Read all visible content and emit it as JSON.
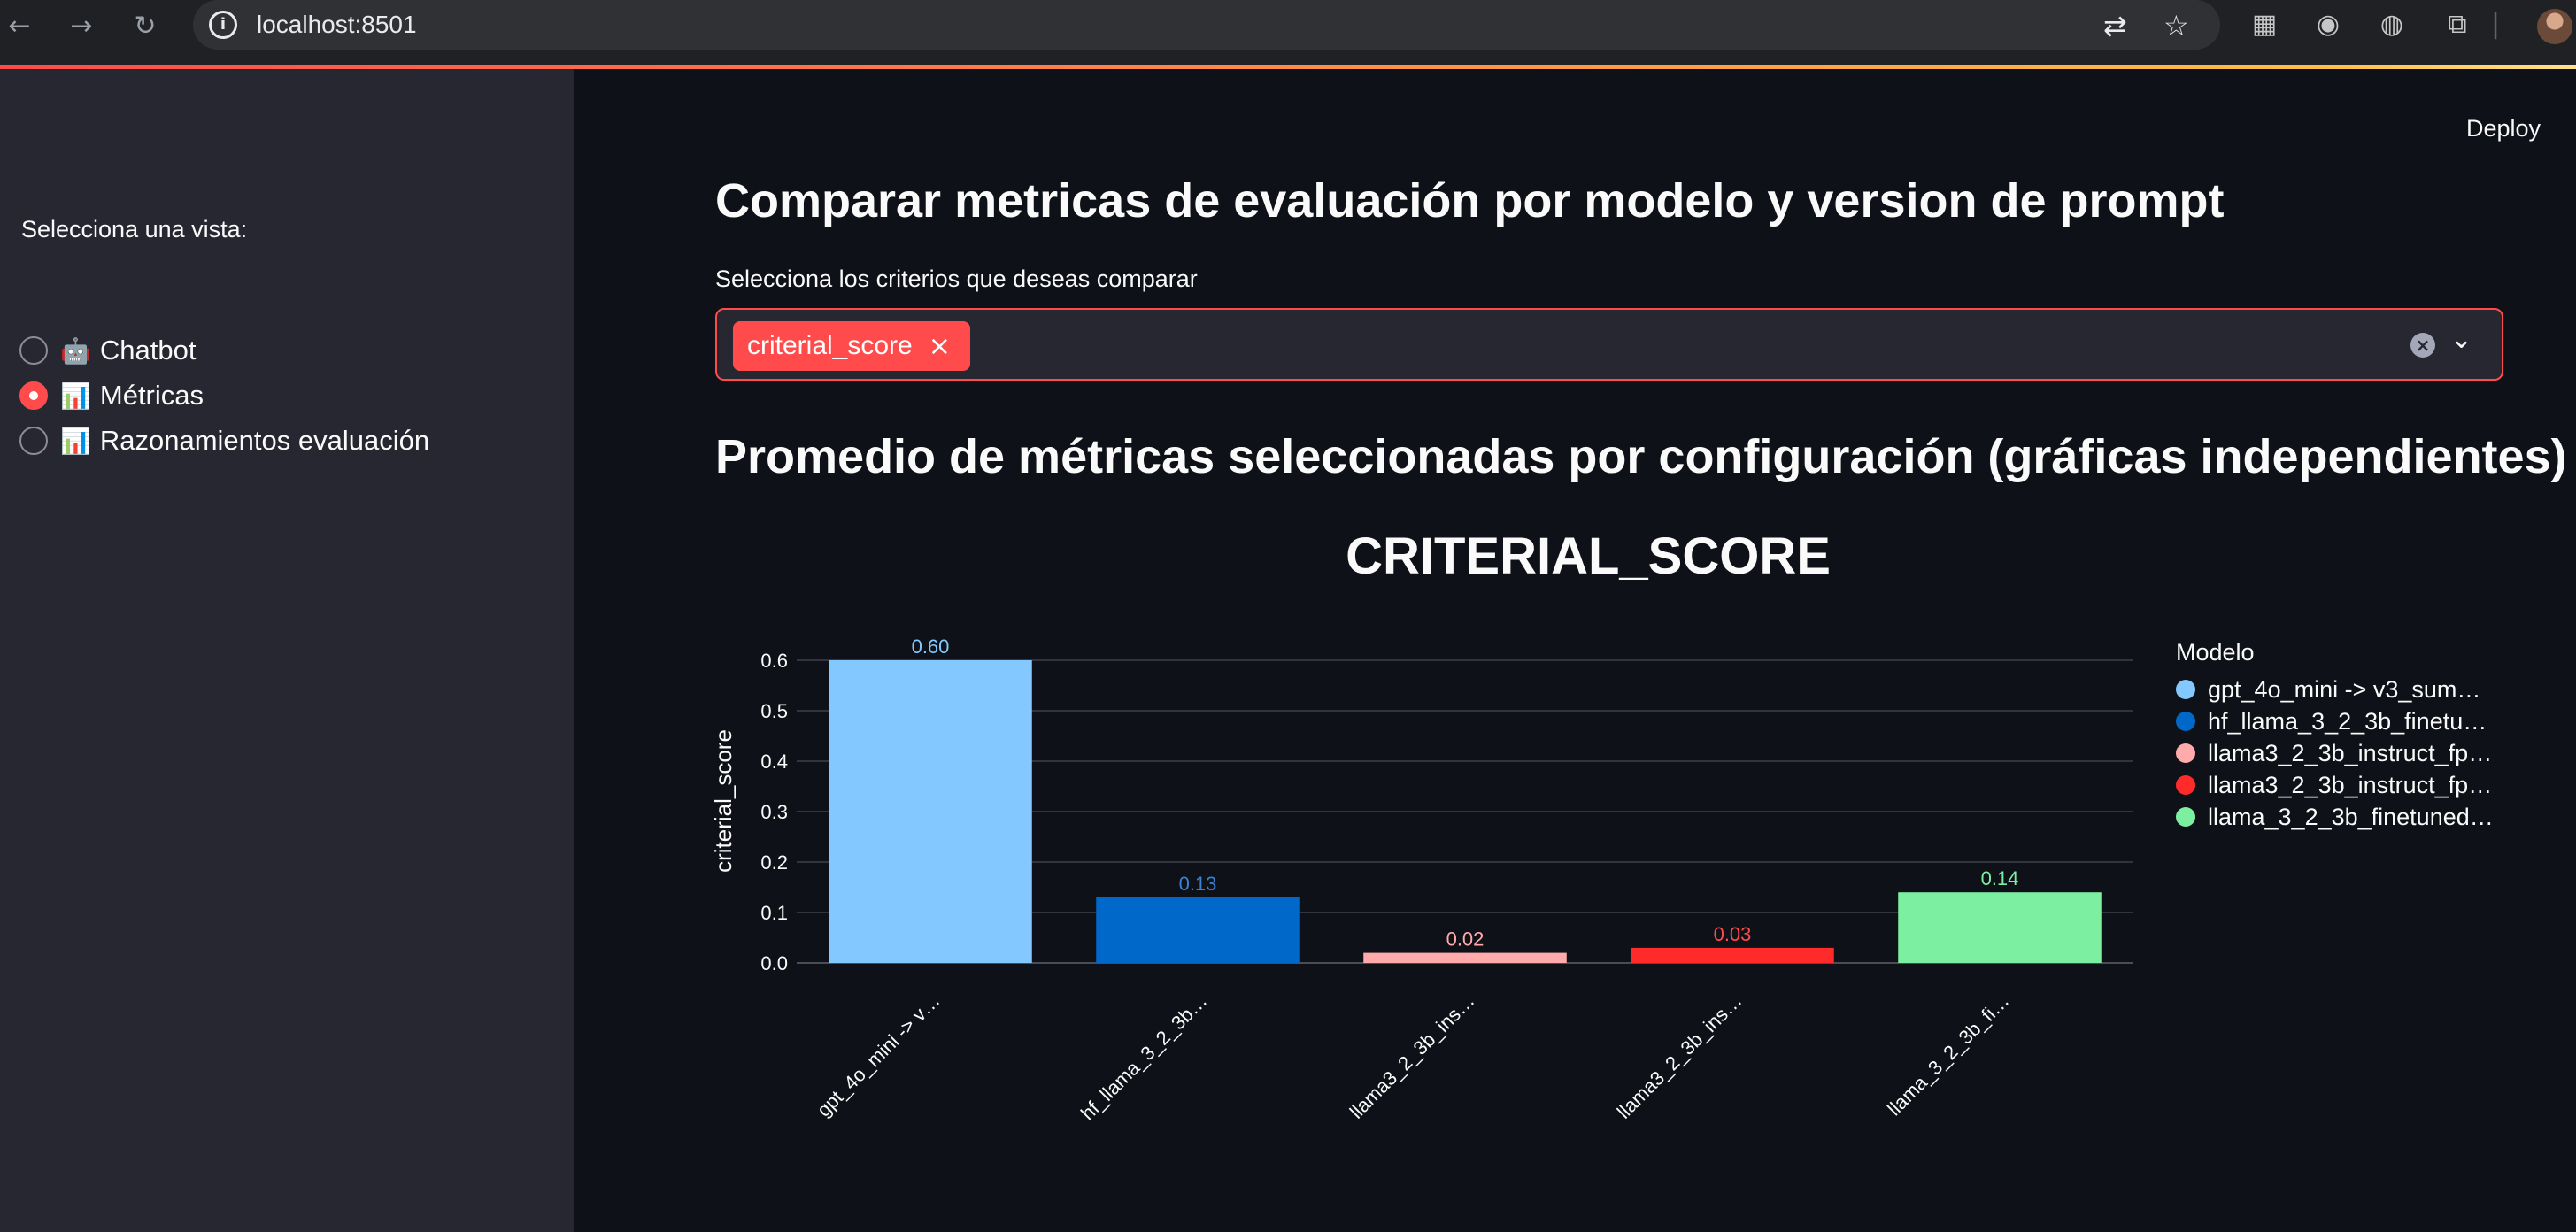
{
  "browser": {
    "url": "localhost:8501",
    "back_icon": "arrow-left-icon",
    "forward_icon": "arrow-right-icon",
    "reload_icon": "reload-icon"
  },
  "header": {
    "deploy_label": "Deploy"
  },
  "sidebar": {
    "label": "Selecciona una vista:",
    "options": [
      {
        "emoji": "🤖",
        "label": "Chatbot",
        "checked": false
      },
      {
        "emoji": "📊",
        "label": "Métricas",
        "checked": true
      },
      {
        "emoji": "📊",
        "label": "Razonamientos evaluación",
        "checked": false
      }
    ]
  },
  "main": {
    "title": "Comparar metricas de evaluación por modelo y version de prompt",
    "multiselect_label": "Selecciona los criterios que deseas comparar",
    "selected_tags": [
      "criterial_score"
    ],
    "subtitle": "Promedio de métricas seleccionadas por configuración (gráficas independientes)"
  },
  "colors": {
    "accent": "#ff4b4b",
    "background": "#0e1117",
    "sidebar": "#262730"
  },
  "chart_data": {
    "type": "bar",
    "title": "CRITERIAL_SCORE",
    "ylabel": "criterial_score",
    "xlabel": "",
    "ylim": [
      0,
      0.6
    ],
    "yticks": [
      "0.0",
      "0.1",
      "0.2",
      "0.3",
      "0.4",
      "0.5",
      "0.6"
    ],
    "grid": true,
    "legend_title": "Modelo",
    "legend_position": "right",
    "categories": [
      "gpt_4o_mini -> v…",
      "hf_llama_3_2_3b…",
      "llama3_2_3b_ins…",
      "llama3_2_3b_ins…",
      "llama_3_2_3b_fi…"
    ],
    "legend_entries": [
      "gpt_4o_mini -> v3_sum…",
      "hf_llama_3_2_3b_finetu…",
      "llama3_2_3b_instruct_fp…",
      "llama3_2_3b_instruct_fp…",
      "llama_3_2_3b_finetuned…"
    ],
    "values": [
      0.6,
      0.13,
      0.02,
      0.03,
      0.14
    ],
    "labels": [
      "0.60",
      "0.13",
      "0.02",
      "0.03",
      "0.14"
    ],
    "colors": [
      "#83c9ff",
      "#0068c9",
      "#ffabab",
      "#ff2b2b",
      "#7defa1"
    ],
    "label_colors": [
      "#83c9ff",
      "#3b82d6",
      "#ffabab",
      "#ff4b4b",
      "#7defa1"
    ]
  }
}
